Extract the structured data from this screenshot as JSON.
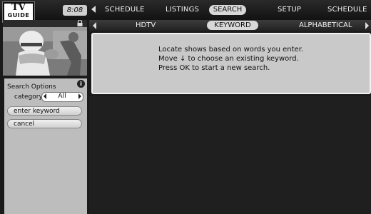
{
  "logo": {
    "line1": "TV",
    "line2": "GUIDE"
  },
  "clock": "8:08",
  "nav": {
    "items": [
      "SCHEDULE",
      "LISTINGS",
      "SEARCH",
      "SETUP",
      "SCHEDULE"
    ],
    "active": "SEARCH"
  },
  "subnav": {
    "items": [
      "HDTV",
      "KEYWORD",
      "ALPHABETICAL"
    ],
    "active": "KEYWORD"
  },
  "search_options": {
    "title": "Search Options",
    "info_icon_text": "i",
    "category_label": "category:",
    "category_value": "All",
    "buttons": [
      "enter keyword",
      "cancel"
    ]
  },
  "message": {
    "line1": "Locate shows based on words you enter.",
    "line2": "Move ↓ to choose an existing keyword.",
    "line3": "Press OK to start a new search."
  },
  "colors": {
    "selected_pill": "#d8d8d8",
    "panel": "#bdbdbd",
    "background": "#1a1a1a"
  }
}
